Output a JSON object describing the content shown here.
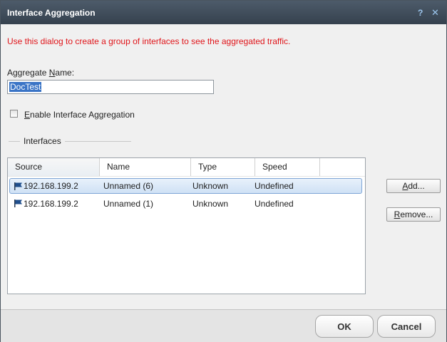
{
  "dialog": {
    "title": "Interface Aggregation",
    "help_glyph": "?",
    "close_glyph": "✕"
  },
  "intro_text": "Use this dialog to create a group of interfaces to see the aggregated traffic.",
  "aggregate": {
    "label_pre": "Aggregate ",
    "label_key": "N",
    "label_post": "ame:",
    "value": "DocTest"
  },
  "enable": {
    "checked": false,
    "label_key": "E",
    "label_post": "nable Interface Aggregation"
  },
  "interfaces_group": {
    "label": "Interfaces"
  },
  "table": {
    "columns": [
      "Source",
      "Name",
      "Type",
      "Speed"
    ],
    "rows": [
      {
        "source": "192.168.199.2",
        "name": "Unnamed (6)",
        "type": "Unknown",
        "speed": "Undefined",
        "selected": true
      },
      {
        "source": "192.168.199.2",
        "name": "Unnamed (1)",
        "type": "Unknown",
        "speed": "Undefined",
        "selected": false
      }
    ],
    "row_icon": "flag-icon"
  },
  "buttons": {
    "add_key": "A",
    "add_post": "dd...",
    "remove_key": "R",
    "remove_post": "emove...",
    "ok": "OK",
    "cancel": "Cancel"
  },
  "colors": {
    "title_bar": "#3f4b58",
    "intro_text": "#e0161b",
    "selection": "#3a74c6",
    "flag": "#1f4e8c"
  }
}
